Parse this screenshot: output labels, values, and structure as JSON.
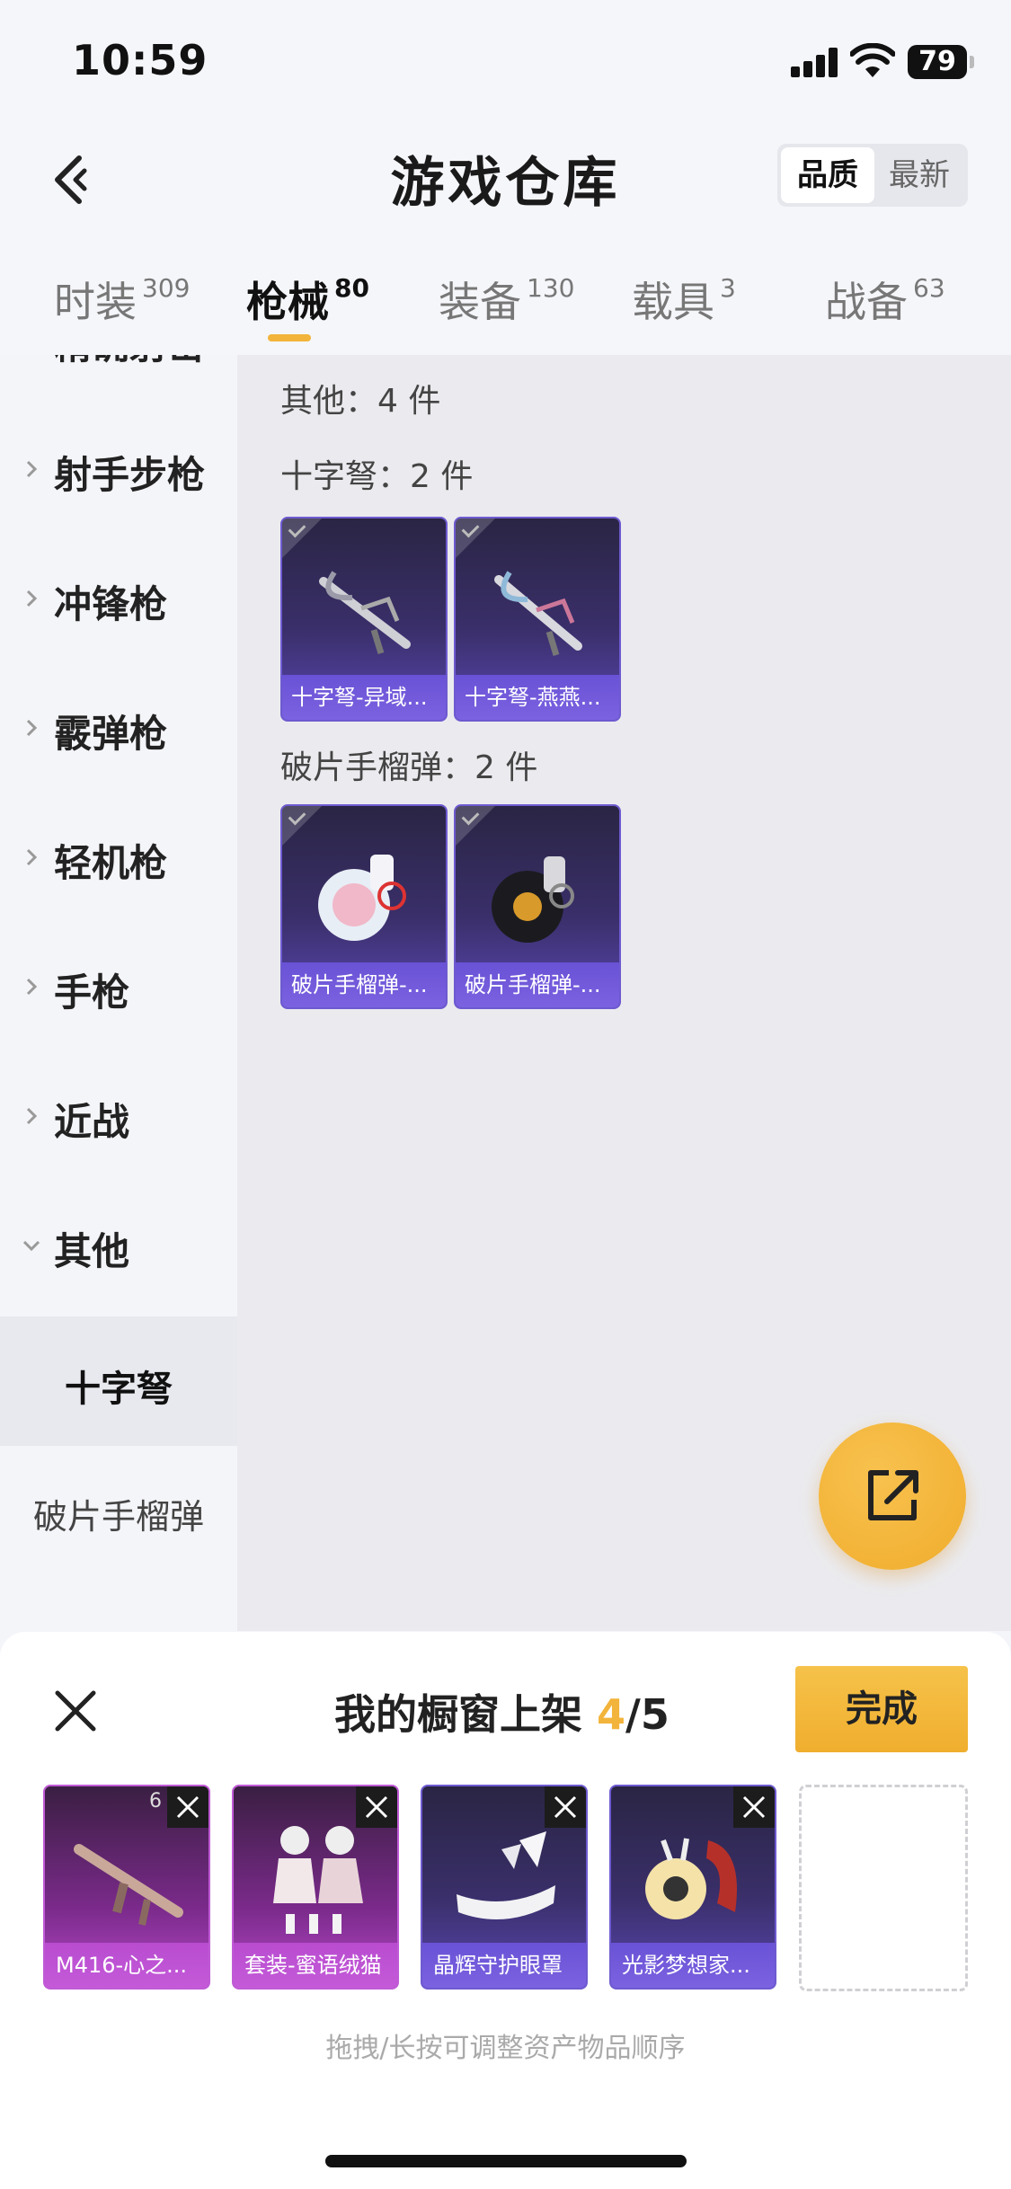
{
  "status_bar": {
    "time": "10:59",
    "battery": "79"
  },
  "header": {
    "title": "游戏仓库",
    "sort_options": [
      "品质",
      "最新"
    ]
  },
  "tabs": [
    {
      "label": "时装",
      "count": "309"
    },
    {
      "label": "枪械",
      "count": "80"
    },
    {
      "label": "装备",
      "count": "130"
    },
    {
      "label": "载具",
      "count": "3"
    },
    {
      "label": "战备",
      "count": "63"
    }
  ],
  "sidebar": {
    "partial_label": "精确射击",
    "items": [
      "射手步枪",
      "冲锋枪",
      "霰弹枪",
      "轻机枪",
      "手枪",
      "近战",
      "其他"
    ],
    "subitems": [
      "十字弩",
      "破片手榴弹"
    ]
  },
  "content": {
    "other_header": "其他：4 件",
    "groups": [
      {
        "title": "十字弩：2 件",
        "items": [
          "十字弩-异域...",
          "十字弩-燕燕..."
        ]
      },
      {
        "title": "破片手榴弹：2 件",
        "items": [
          "破片手榴弹-...",
          "破片手榴弹-..."
        ]
      }
    ]
  },
  "panel": {
    "title": "我的橱窗上架",
    "count": "4",
    "total": "/5",
    "done_label": "完成",
    "items": [
      {
        "caption": "M416-心之...",
        "corner": "6"
      },
      {
        "caption": "套装-蜜语绒猫"
      },
      {
        "caption": "晶辉守护眼罩"
      },
      {
        "caption": "光影梦想家..."
      }
    ],
    "hint": "拖拽/长按可调整资产物品顺序"
  },
  "colors": {
    "accent": "#f2b43a",
    "card_purple": "#5a46b0",
    "card_pink": "#b447c8"
  },
  "icons": [
    "back-arrow-icon",
    "chevron-right-icon",
    "chevron-down-icon",
    "share-icon",
    "close-icon",
    "remove-icon",
    "check-icon"
  ]
}
